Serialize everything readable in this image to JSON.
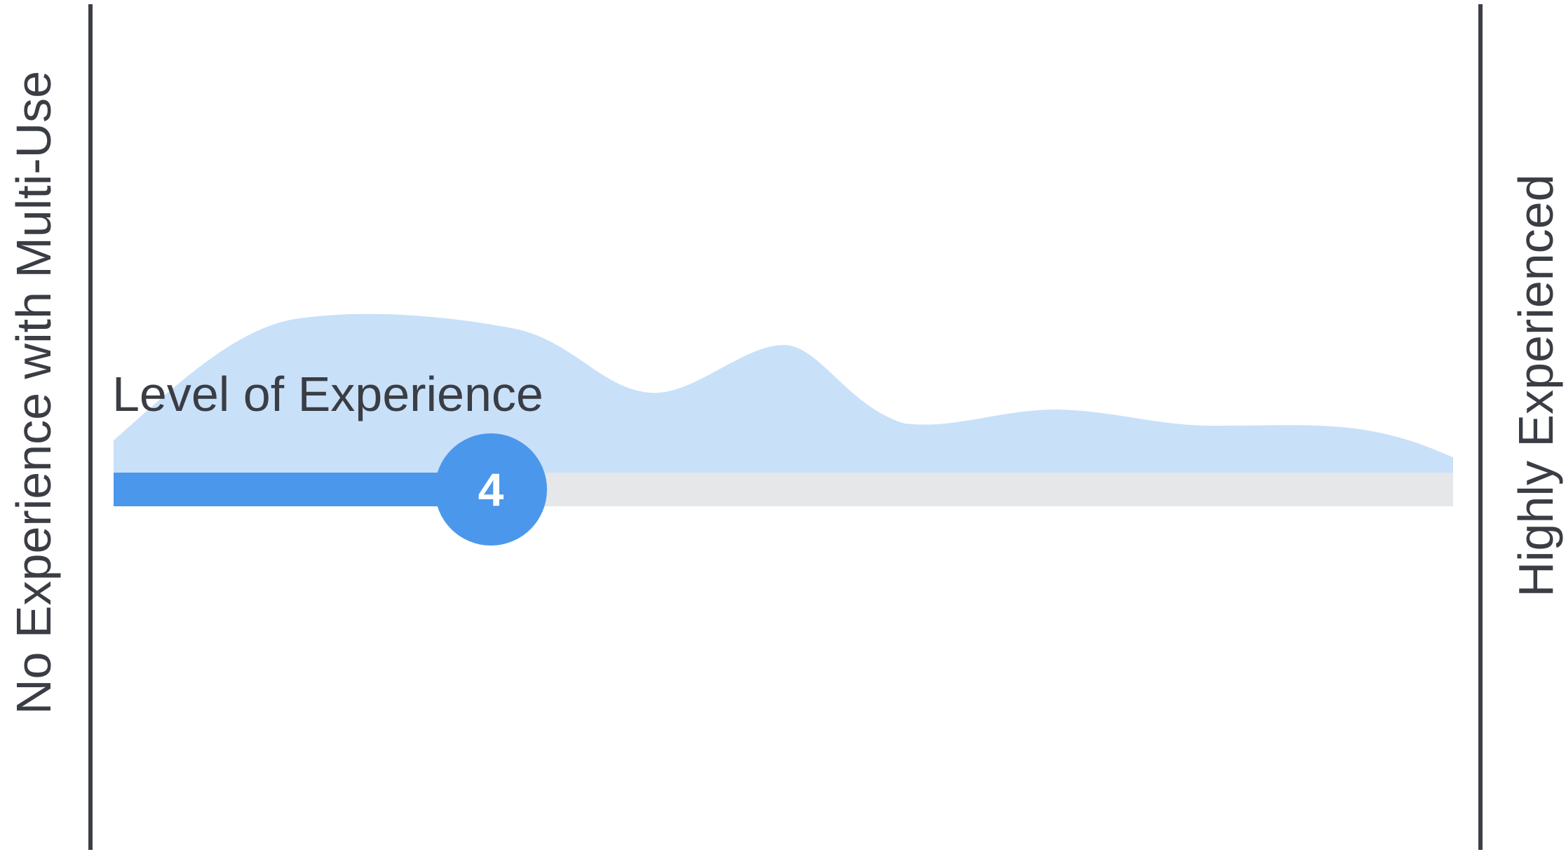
{
  "left_label": "No Experience with Multi-Use",
  "right_label": "Highly Experienced",
  "slider": {
    "title": "Level of Experience",
    "value": "4",
    "fraction": 0.4
  },
  "colors": {
    "accent": "#4b97ec",
    "distribution": "#c9e0f9",
    "track": "#e6e7e9",
    "lines": "#3c3f46",
    "text": "#3a3d44"
  }
}
